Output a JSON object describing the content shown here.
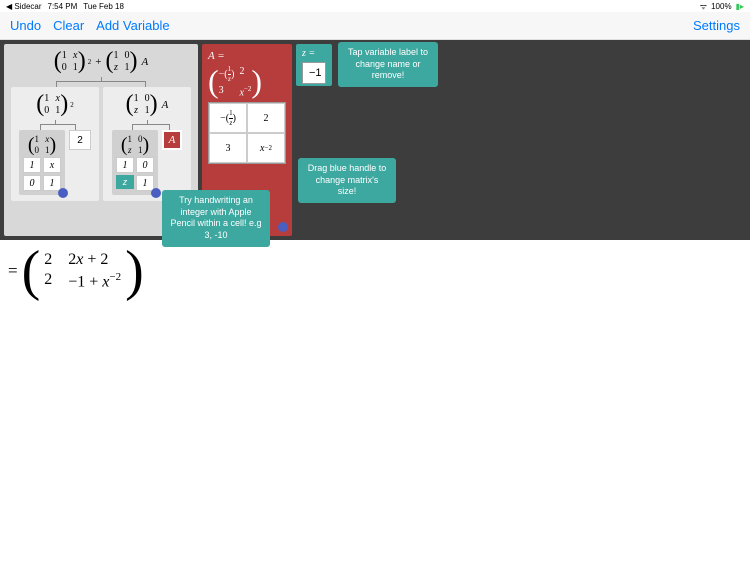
{
  "status": {
    "sidecar": "◀ Sidecar",
    "time": "7:54 PM",
    "date": "Tue Feb 18",
    "wifi": "wifi",
    "battery": "100%"
  },
  "toolbar": {
    "undo": "Undo",
    "clear": "Clear",
    "add_var": "Add Variable",
    "settings": "Settings"
  },
  "top_expr": {
    "left_mat": [
      [
        "1",
        "x"
      ],
      [
        "0",
        "1"
      ]
    ],
    "left_sup": "2",
    "plus": "+",
    "right_mat": [
      [
        "1",
        "0"
      ],
      [
        "z",
        "1"
      ]
    ],
    "right_var": "A"
  },
  "left_branch": {
    "header_mat": [
      [
        "1",
        "x"
      ],
      [
        "0",
        "1"
      ]
    ],
    "header_sup": "2",
    "sub_mat": [
      [
        "1",
        "x"
      ],
      [
        "0",
        "1"
      ]
    ],
    "power_box": "2",
    "cells": [
      [
        "1",
        "x"
      ],
      [
        "0",
        "1"
      ]
    ]
  },
  "right_branch": {
    "header_mat": [
      [
        "1",
        "0"
      ],
      [
        "z",
        "1"
      ]
    ],
    "header_var": "A",
    "sub_mat": [
      [
        "1",
        "0"
      ],
      [
        "z",
        "1"
      ]
    ],
    "cells": [
      [
        "1",
        "0"
      ],
      [
        "z",
        "1"
      ]
    ],
    "A_label": "A"
  },
  "var_A": {
    "header": "A =",
    "display": [
      [
        "−(1/z)",
        "2"
      ],
      [
        "3",
        "x⁻²"
      ]
    ],
    "cells": [
      [
        "-\\tfrac{1}{z}",
        "2"
      ],
      [
        "3",
        "x^{-2}"
      ]
    ]
  },
  "var_z": {
    "header": "z =",
    "value": "−1"
  },
  "tooltips": {
    "tap_var": "Tap variable label to change name or remove!",
    "drag_handle": "Drag blue handle to change matrix's size!",
    "handwrite": "Try handwriting an integer with Apple Pencil within a cell! e.g 3, -10"
  },
  "result": {
    "eq": "=",
    "mat": [
      [
        "2",
        "2x + 2"
      ],
      [
        "2",
        "−1 + x⁻²"
      ]
    ]
  }
}
